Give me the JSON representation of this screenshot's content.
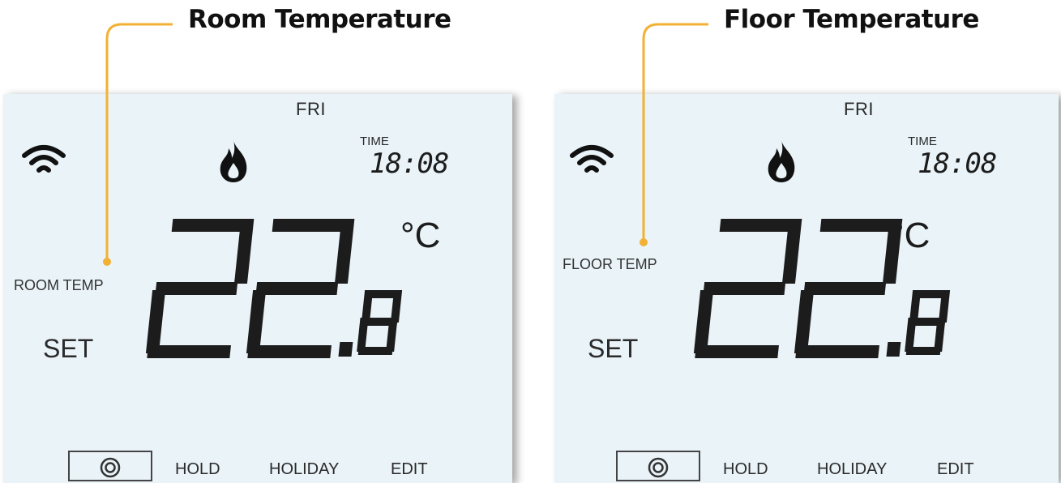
{
  "callouts": {
    "left": "Room Temperature",
    "right": "Floor Temperature"
  },
  "colors": {
    "accent": "#f2b134",
    "screen_background": "#e9f3f8",
    "segment": "#1c1c1c"
  },
  "panels": [
    {
      "day": "FRI",
      "time_label": "TIME",
      "time": "18:08",
      "temp_label": "ROOM TEMP",
      "set_label": "SET",
      "temperature": "22.8",
      "unit": "°C",
      "icons": [
        "wifi-icon",
        "flame-icon",
        "target-icon"
      ],
      "menu": {
        "hold": "HOLD",
        "holiday": "HOLIDAY",
        "edit": "EDIT"
      }
    },
    {
      "day": "FRI",
      "time_label": "TIME",
      "time": "18:08",
      "temp_label": "FLOOR TEMP",
      "set_label": "SET",
      "temperature": "22.8",
      "unit": "°C",
      "icons": [
        "wifi-icon",
        "flame-icon",
        "target-icon"
      ],
      "menu": {
        "hold": "HOLD",
        "holiday": "HOLIDAY",
        "edit": "EDIT"
      }
    }
  ]
}
